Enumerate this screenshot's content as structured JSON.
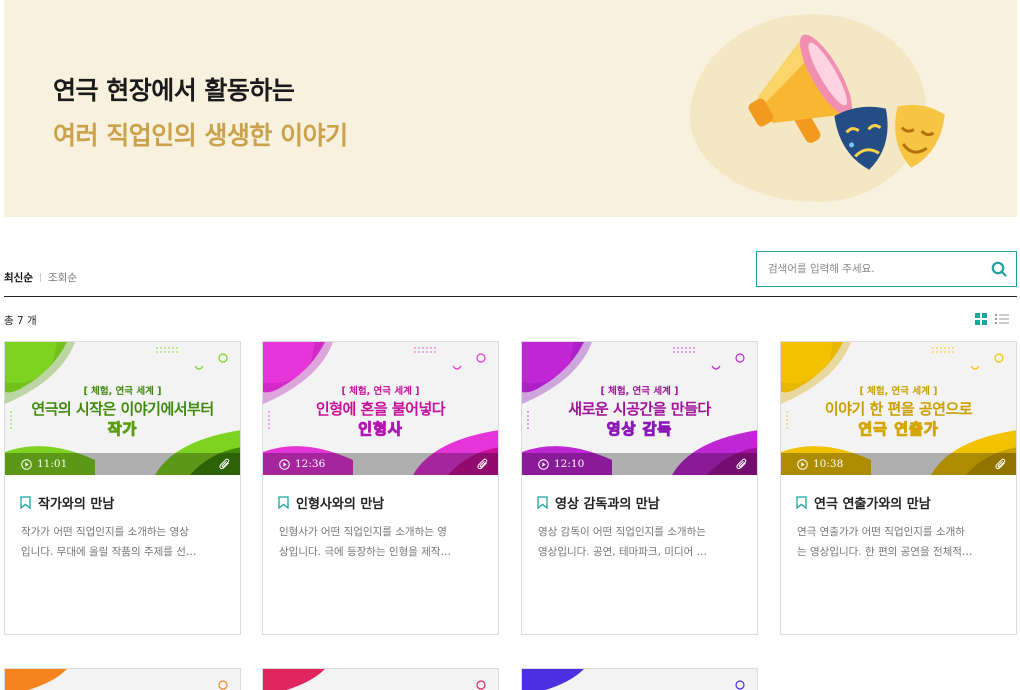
{
  "hero": {
    "line1": "연극 현장에서 활동하는",
    "line2": "여러 직업인의 생생한 이야기"
  },
  "sort": {
    "active": "최신순",
    "other": "조회순"
  },
  "search": {
    "placeholder": "검색어를 입력해 주세요."
  },
  "count": "총 7 개",
  "cards": [
    {
      "tag": "[ 체험, 연극 세계 ]",
      "title": "연극의 시작은 이야기에서부터",
      "subtitle": "작가",
      "time": "11:01",
      "name": "작가와의 만남",
      "desc1": "작가가 어떤 직업인지를 소개하는 영상",
      "desc2": "입니다. 무대에 올릴 작품의 주제를 선…",
      "colors": {
        "main": "#7ed321",
        "dark": "#5a9e10",
        "accent": "#3f8a0b"
      }
    },
    {
      "tag": "[ 체험, 연극 세계 ]",
      "title": "인형에 혼을 불어넣다",
      "subtitle": "인형사",
      "time": "12:36",
      "name": "인형사와의 만남",
      "desc1": "인형사가 어떤 직업인지를 소개하는 영",
      "desc2": "상입니다. 극에 등장하는 인형을 제작…",
      "colors": {
        "main": "#e535d8",
        "dark": "#b314b0",
        "accent": "#c90e9a"
      }
    },
    {
      "tag": "[ 체험, 연극 세계 ]",
      "title": "새로운 시공간을 만들다",
      "subtitle": "영상 감독",
      "time": "12:10",
      "name": "영상 감독과의 만남",
      "desc1": "영상 감독이 어떤 직업인지를 소개하는",
      "desc2": "영상입니다. 공연, 테마파크, 미디어 …",
      "colors": {
        "main": "#c026d3",
        "dark": "#8a18b8",
        "accent": "#a0129a"
      }
    },
    {
      "tag": "[ 체험, 연극 세계 ]",
      "title": "이야기 한 편을 공연으로",
      "subtitle": "연극 연출가",
      "time": "10:38",
      "name": "연극 연출가와의 만남",
      "desc1": "연극 연출가가 어떤 직업인지를 소개하",
      "desc2": "는 영상입니다. 한 편의 공연을 전체적…",
      "colors": {
        "main": "#f2c200",
        "dark": "#d6a600",
        "accent": "#caa000"
      }
    }
  ],
  "partial_cards": [
    {
      "color": "#f5841f"
    },
    {
      "color": "#e0245e"
    },
    {
      "color": "#4b2fe0"
    }
  ]
}
